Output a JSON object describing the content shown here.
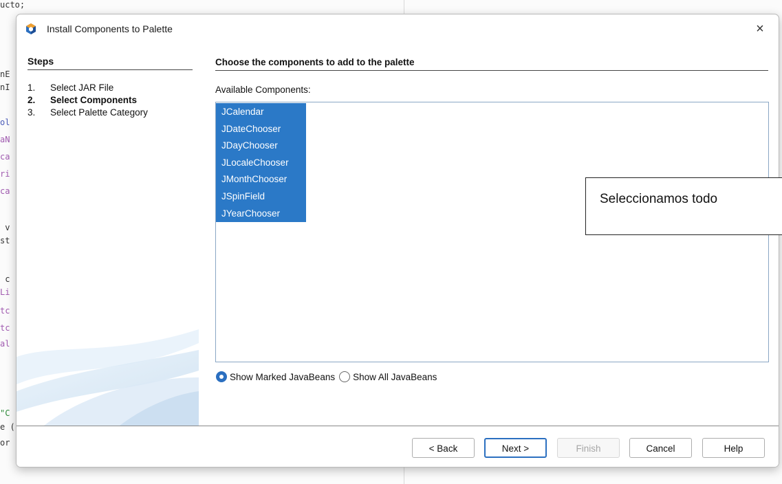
{
  "dialog": {
    "title": "Install Components to Palette",
    "close_symbol": "×"
  },
  "steps": {
    "heading": "Steps",
    "items": [
      {
        "number": "1.",
        "label": "Select JAR File",
        "current": false
      },
      {
        "number": "2.",
        "label": "Select Components",
        "current": true
      },
      {
        "number": "3.",
        "label": "Select Palette Category",
        "current": false
      }
    ]
  },
  "content": {
    "heading": "Choose the components to add to the palette",
    "available_label": "Available Components:",
    "components": [
      {
        "name": "JCalendar",
        "selected": true
      },
      {
        "name": "JDateChooser",
        "selected": true
      },
      {
        "name": "JDayChooser",
        "selected": true
      },
      {
        "name": "JLocaleChooser",
        "selected": true
      },
      {
        "name": "JMonthChooser",
        "selected": true
      },
      {
        "name": "JSpinField",
        "selected": true
      },
      {
        "name": "JYearChooser",
        "selected": true
      }
    ],
    "radio_options": [
      {
        "label": "Show Marked JavaBeans",
        "checked": true
      },
      {
        "label": "Show All JavaBeans",
        "checked": false
      }
    ]
  },
  "buttons": {
    "back": "< Back",
    "next": "Next >",
    "finish": "Finish",
    "cancel": "Cancel",
    "help": "Help"
  },
  "annotation": {
    "text": "Seleccionamos todo"
  },
  "background_editor": {
    "code_fragments": [
      {
        "text": "ucto;",
        "color": "#333333"
      },
      {
        "text": "nE",
        "color": "#333333"
      },
      {
        "text": "nI",
        "color": "#333333"
      },
      {
        "text": "ol",
        "color": "#4a5bb8"
      },
      {
        "text": "aN",
        "color": "#a05ab0"
      },
      {
        "text": "ca",
        "color": "#a05ab0"
      },
      {
        "text": "ri",
        "color": "#a05ab0"
      },
      {
        "text": "ca",
        "color": "#a05ab0"
      },
      {
        "text": " v",
        "color": "#333333"
      },
      {
        "text": "st",
        "color": "#333333"
      },
      {
        "text": " c",
        "color": "#333333"
      },
      {
        "text": "Li",
        "color": "#a05ab0"
      },
      {
        "text": "tc",
        "color": "#a05ab0"
      },
      {
        "text": "tc",
        "color": "#a05ab0"
      },
      {
        "text": "al",
        "color": "#a05ab0"
      },
      {
        "text": "\"C",
        "color": "#2e8b3a"
      },
      {
        "text": "e (",
        "color": "#333333"
      },
      {
        "text": "or",
        "color": "#333333"
      }
    ]
  },
  "colors": {
    "selection": "#2b79c7",
    "accent": "#2b6fc0"
  }
}
